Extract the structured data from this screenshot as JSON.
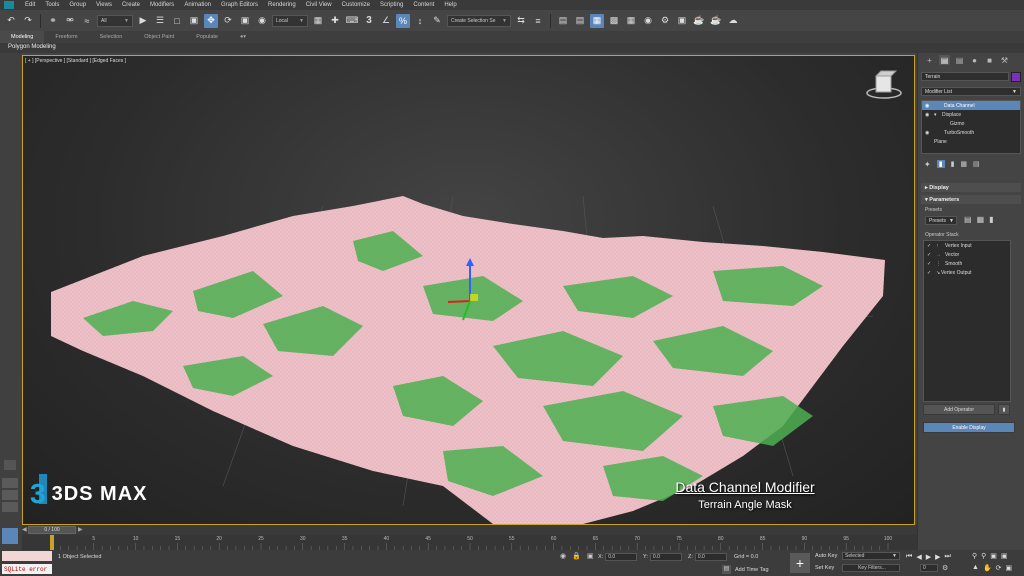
{
  "menu": [
    "Edit",
    "Tools",
    "Group",
    "Views",
    "Create",
    "Modifiers",
    "Animation",
    "Graph Editors",
    "Rendering",
    "Civil View",
    "Customize",
    "Scripting",
    "Content",
    "Help"
  ],
  "toolbar": {
    "selection_filter": "All",
    "coordinate_system": "Local",
    "snaps_value": "3",
    "named_selection_placeholder": "Create Selection Se"
  },
  "ribbon": {
    "tabs": [
      "Modeling",
      "Freeform",
      "Selection",
      "Object Paint",
      "Populate"
    ],
    "active_tab": "Modeling",
    "panel_label": "Polygon Modeling"
  },
  "viewport": {
    "label": "[ + ] [Perspective ] [Standard ] [Edged Faces ]"
  },
  "command_panel": {
    "object_name": "Terrain",
    "object_color": "#7b2fbf",
    "modifier_list_label": "Modifier List",
    "stack": [
      {
        "label": "Data Channel",
        "selected": true,
        "eye": true,
        "indent": 0
      },
      {
        "label": "Displace",
        "selected": false,
        "eye": true,
        "indent": 0,
        "expanded": true
      },
      {
        "label": "Gizmo",
        "selected": false,
        "eye": false,
        "indent": 1
      },
      {
        "label": "TurboSmooth",
        "selected": false,
        "eye": true,
        "indent": 0
      },
      {
        "label": "Plane",
        "selected": false,
        "eye": false,
        "indent": 0
      }
    ],
    "display_rollout": "Display",
    "parameters_rollout": "Parameters",
    "presets_label": "Presets",
    "presets_dropdown": "Presets",
    "operator_stack_label": "Operator Stack",
    "operators": [
      "Vertex Input",
      "Vector",
      "Smooth",
      "Vertex Output"
    ],
    "add_operator_label": "Add Operator",
    "enable_display_label": "Enable Display"
  },
  "timeline": {
    "frame_display": "0 / 100",
    "ticks": [
      "0",
      "5",
      "10",
      "15",
      "20",
      "25",
      "30",
      "35",
      "40",
      "45",
      "50",
      "55",
      "60",
      "65",
      "70",
      "75",
      "80",
      "85",
      "90",
      "95",
      "100"
    ]
  },
  "status": {
    "selection_text": "1 Object Selected",
    "x_label": "X:",
    "x_value": "0.0",
    "y_label": "Y:",
    "y_value": "0.0",
    "z_label": "Z:",
    "z_value": "0.0",
    "grid_text": "Grid = 0.0",
    "add_time_tag": "Add Time Tag",
    "auto_key_label": "Auto Key",
    "set_key_label": "Set Key",
    "selected_dropdown": "Selected",
    "key_filters_label": "Key Filters...",
    "frame_field": "0",
    "listener_error": "SQLite error"
  },
  "overlay": {
    "brand_mark": "3",
    "brand_name": "3DS MAX",
    "caption_title": "Data Channel Modifier",
    "caption_subtitle": "Terrain Angle Mask"
  },
  "colors": {
    "accent_blue": "#5b86b8",
    "viewport_border": "#c9a227",
    "terrain_pink": "#e9b8c0",
    "terrain_green": "#4caf50"
  }
}
